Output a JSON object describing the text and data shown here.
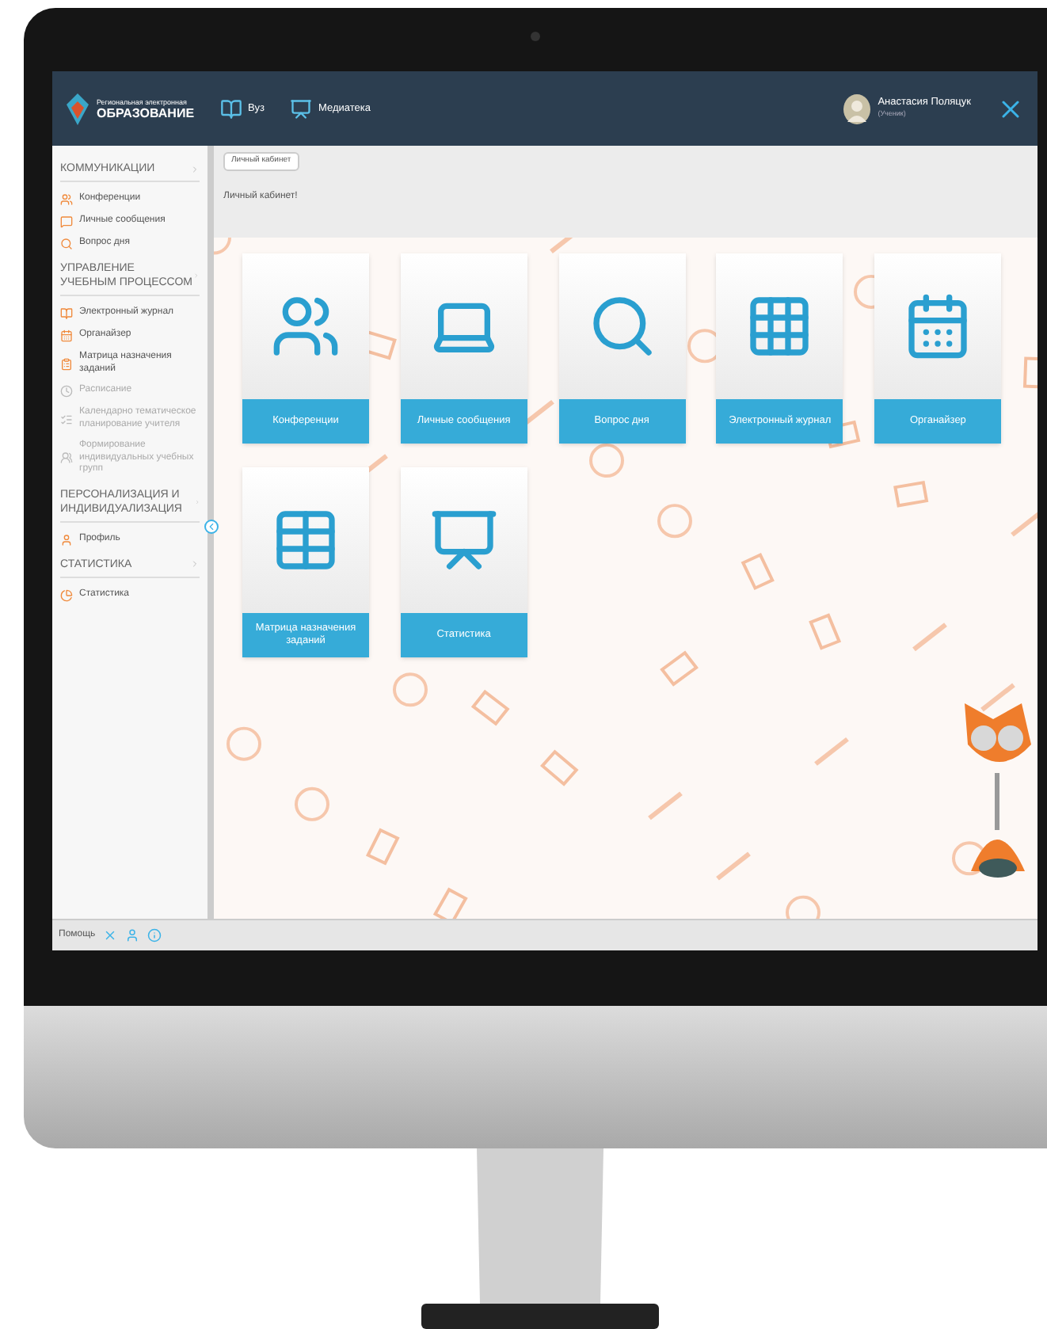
{
  "logo": {
    "top": "Региональная электронная",
    "main": "ОБРАЗОВАНИЕ"
  },
  "nav": [
    {
      "label": "Вуз"
    },
    {
      "label": "Медиатека"
    }
  ],
  "user": {
    "name": "Анастасия Поляцук",
    "role": "(Ученик)"
  },
  "sidebar": {
    "sections": [
      {
        "title": "КОММУНИКАЦИИ",
        "items": [
          {
            "label": "Конференции",
            "disabled": false
          },
          {
            "label": "Личные сообщения",
            "disabled": false
          },
          {
            "label": "Вопрос дня",
            "disabled": false
          }
        ]
      },
      {
        "title": "УПРАВЛЕНИЕ УЧЕБНЫМ ПРОЦЕССОМ",
        "items": [
          {
            "label": "Электронный журнал",
            "disabled": false
          },
          {
            "label": "Органайзер",
            "disabled": false
          },
          {
            "label": "Матрица назначения заданий",
            "disabled": false
          },
          {
            "label": "Расписание",
            "disabled": true
          },
          {
            "label": "Календарно тематическое планирование учителя",
            "disabled": true
          },
          {
            "label": "Формирование индивидуальных учебных групп",
            "disabled": true
          }
        ]
      },
      {
        "title": "ПЕРСОНАЛИЗАЦИЯ И ИНДИВИДУАЛИЗАЦИЯ",
        "items": [
          {
            "label": "Профиль",
            "disabled": false
          }
        ]
      },
      {
        "title": "СТАТИСТИКА",
        "items": [
          {
            "label": "Статистика",
            "disabled": false
          }
        ]
      }
    ]
  },
  "footer": {
    "label": "Помощь"
  },
  "breadcrumb": "Личный кабинет",
  "heading": "Личный кабинет!",
  "tiles": [
    {
      "label": "Конференции",
      "kind": "conference"
    },
    {
      "label": "Личные сообщения",
      "kind": "messages"
    },
    {
      "label": "Вопрос дня",
      "kind": "question"
    },
    {
      "label": "Электронный журнал",
      "kind": "journal"
    },
    {
      "label": "Органайзер",
      "kind": "organizer"
    },
    {
      "label": "Матрица назначения заданий",
      "kind": "matrix"
    },
    {
      "label": "Статистика",
      "kind": "stats"
    }
  ]
}
